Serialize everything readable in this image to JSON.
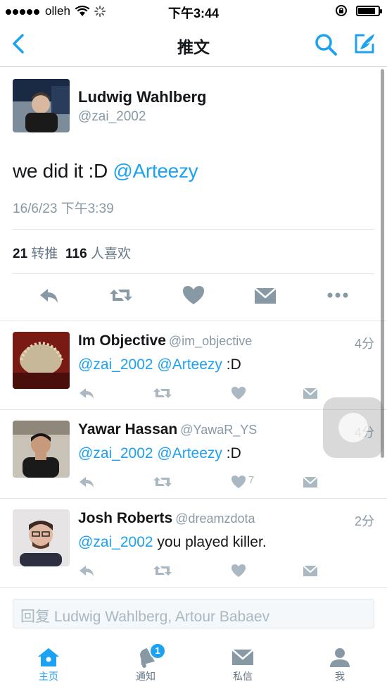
{
  "status_bar": {
    "carrier": "olleh",
    "time": "下午3:44",
    "battery_level": 0.85
  },
  "nav": {
    "title": "推文"
  },
  "tweet": {
    "author_name": "Ludwig Wahlberg",
    "author_handle": "@zai_2002",
    "text": "we did it :D",
    "mention": "@Arteezy",
    "timestamp": "16/6/23 下午3:39",
    "retweet_count": "21",
    "retweet_label": "转推",
    "like_count": "116",
    "like_label": "人喜欢"
  },
  "replies": [
    {
      "name": "Im Objective",
      "handle": "@im_objective",
      "time": "4分",
      "mention1": "@zai_2002",
      "mention2": "@Arteezy",
      "text": " :D",
      "like_count": ""
    },
    {
      "name": "Yawar Hassan",
      "handle": "@YawaR_YS",
      "time": "4分",
      "mention1": "@zai_2002",
      "mention2": "@Arteezy",
      "text": " :D",
      "like_count": "7"
    },
    {
      "name": "Josh Roberts",
      "handle": "@dreamzdota",
      "time": "2分",
      "mention1": "@zai_2002",
      "mention2": "",
      "text": " you played killer.",
      "like_count": ""
    }
  ],
  "reply_box": {
    "placeholder": "回复 Ludwig Wahlberg, Artour Babaev"
  },
  "tabs": [
    {
      "label": "主页",
      "icon": "home-icon",
      "active": true
    },
    {
      "label": "通知",
      "icon": "bell-icon",
      "badge": "1"
    },
    {
      "label": "私信",
      "icon": "mail-icon"
    },
    {
      "label": "我",
      "icon": "person-icon"
    }
  ],
  "colors": {
    "accent": "#1da1f2",
    "icon_gray": "#8899a6",
    "text": "#14171a"
  }
}
